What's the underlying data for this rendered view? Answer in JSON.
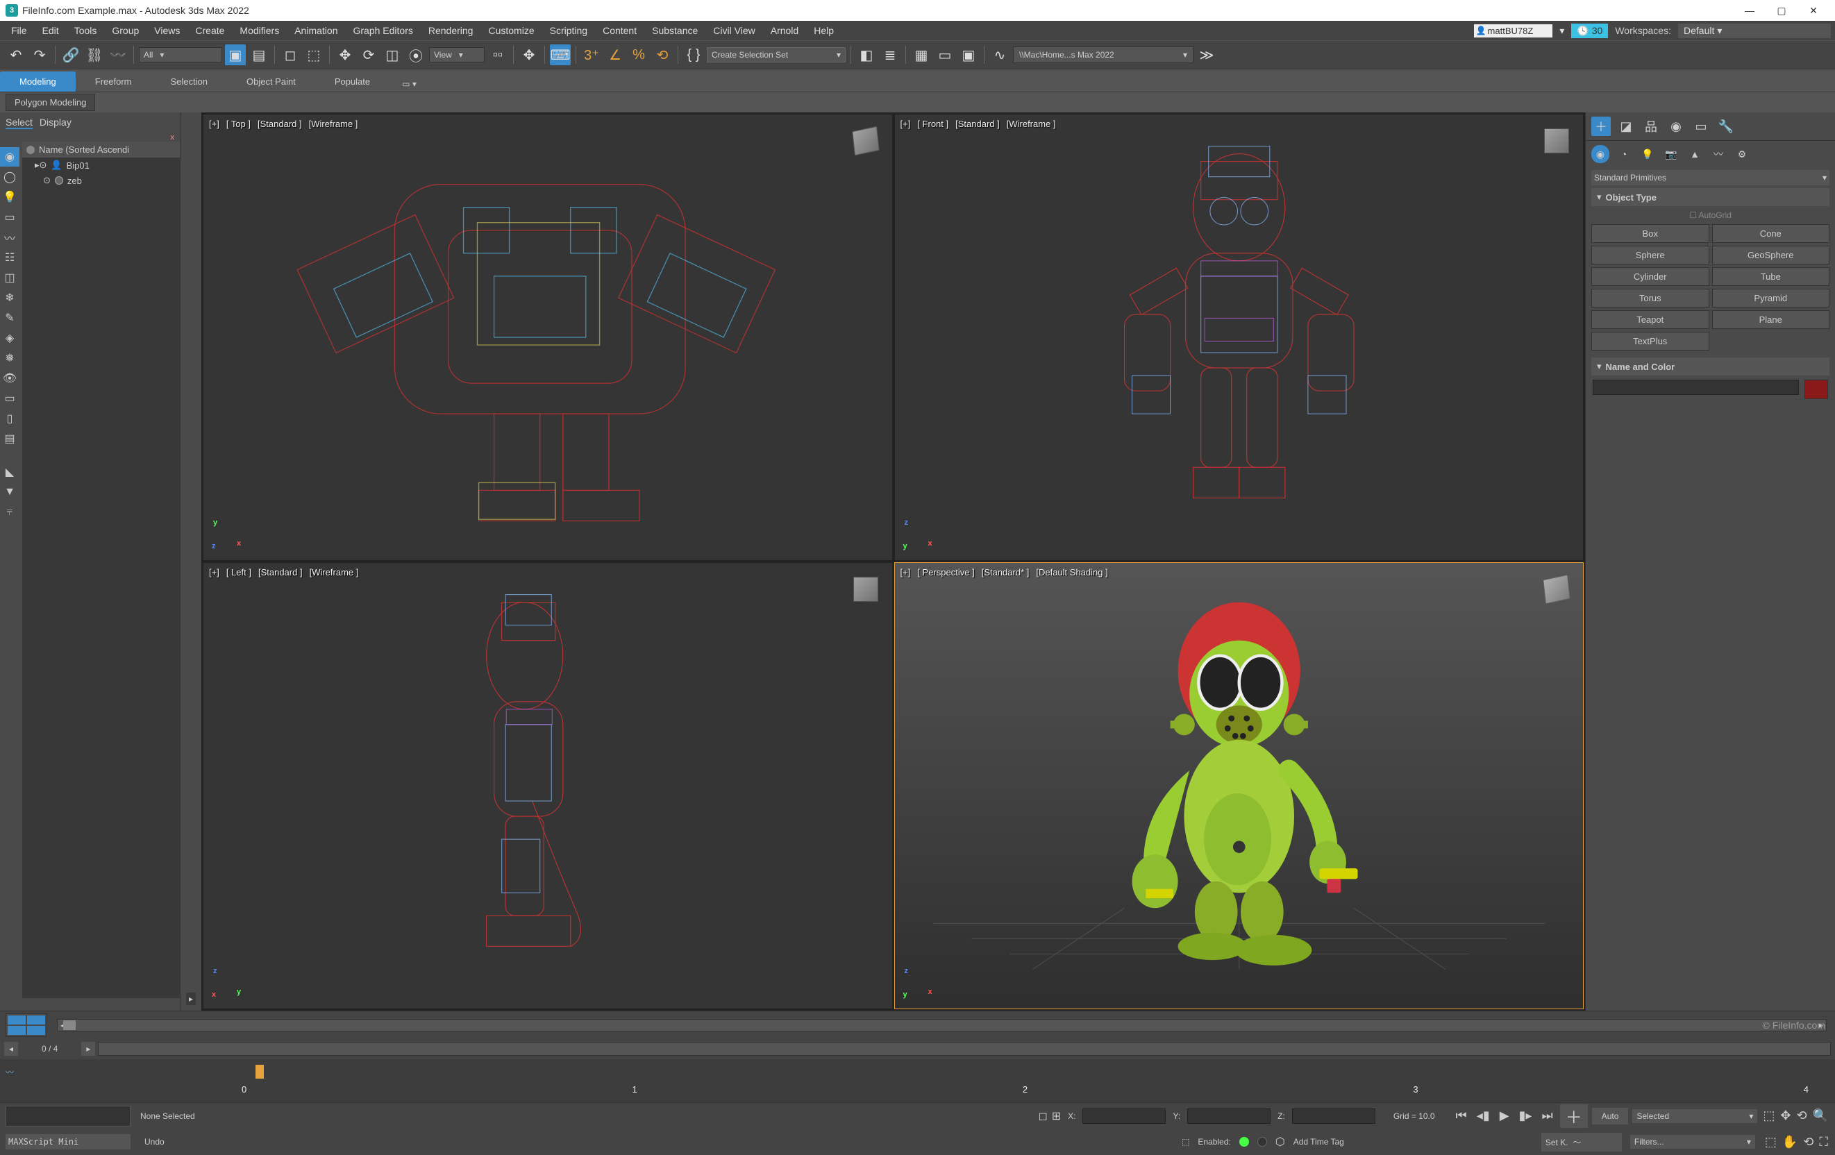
{
  "window": {
    "title": "FileInfo.com Example.max - Autodesk 3ds Max 2022",
    "logo_char": "3"
  },
  "menus": [
    "File",
    "Edit",
    "Tools",
    "Group",
    "Views",
    "Create",
    "Modifiers",
    "Animation",
    "Graph Editors",
    "Rendering",
    "Customize",
    "Scripting",
    "Content",
    "Substance",
    "Civil View",
    "Arnold",
    "Help"
  ],
  "user": {
    "name": "mattBU78Z",
    "cloud_badge": "30",
    "workspace_label": "Workspaces:",
    "workspace_value": "Default"
  },
  "toolbar": {
    "filter_drop": "All",
    "view_drop": "View",
    "create_selset": "Create Selection Set",
    "path": "\\\\Mac\\Home...s Max 2022"
  },
  "ribbon_tabs": [
    "Modeling",
    "Freeform",
    "Selection",
    "Object Paint",
    "Populate"
  ],
  "subribbon": "Polygon Modeling",
  "scene_explorer": {
    "tabs": [
      "Select",
      "Display"
    ],
    "header": "Name (Sorted Ascendi",
    "items": [
      {
        "name": "Bip01"
      },
      {
        "name": "zeb"
      }
    ]
  },
  "pointersmall_x": "x",
  "viewports": [
    {
      "corners": "[+]",
      "view": "[ Top ]",
      "shading": "[Standard ]",
      "style": "[Wireframe ]",
      "type": "ortho"
    },
    {
      "corners": "[+]",
      "view": "[ Front ]",
      "shading": "[Standard ]",
      "style": "[Wireframe ]",
      "type": "ortho"
    },
    {
      "corners": "[+]",
      "view": "[ Left ]",
      "shading": "[Standard ]",
      "style": "[Wireframe ]",
      "type": "ortho"
    },
    {
      "corners": "[+]",
      "view": "[ Perspective ]",
      "shading": "[Standard* ]",
      "style": "[Default Shading ]",
      "type": "persp"
    }
  ],
  "right_panel": {
    "category": "Standard Primitives",
    "object_type_label": "Object Type",
    "autogrid_label": "AutoGrid",
    "primitives": [
      "Box",
      "Cone",
      "Sphere",
      "GeoSphere",
      "Cylinder",
      "Tube",
      "Torus",
      "Pyramid",
      "Teapot",
      "Plane",
      "TextPlus"
    ],
    "name_color_label": "Name and Color"
  },
  "time": {
    "current_frame": "0 / 4",
    "ticks": [
      "0",
      "1",
      "2",
      "3",
      "4"
    ]
  },
  "status": {
    "selection": "None Selected",
    "xl": "X:",
    "yl": "Y:",
    "zl": "Z:",
    "grid": "Grid = 10.0",
    "auto_btn": "Auto",
    "selected_drop": "Selected",
    "maxscript": "MAXScript Mini",
    "undo": "Undo",
    "enabled": "Enabled:",
    "add_time_tag": "Add Time Tag",
    "setk": "Set K.",
    "filters": "Filters..."
  },
  "watermark": "© FileInfo.com"
}
